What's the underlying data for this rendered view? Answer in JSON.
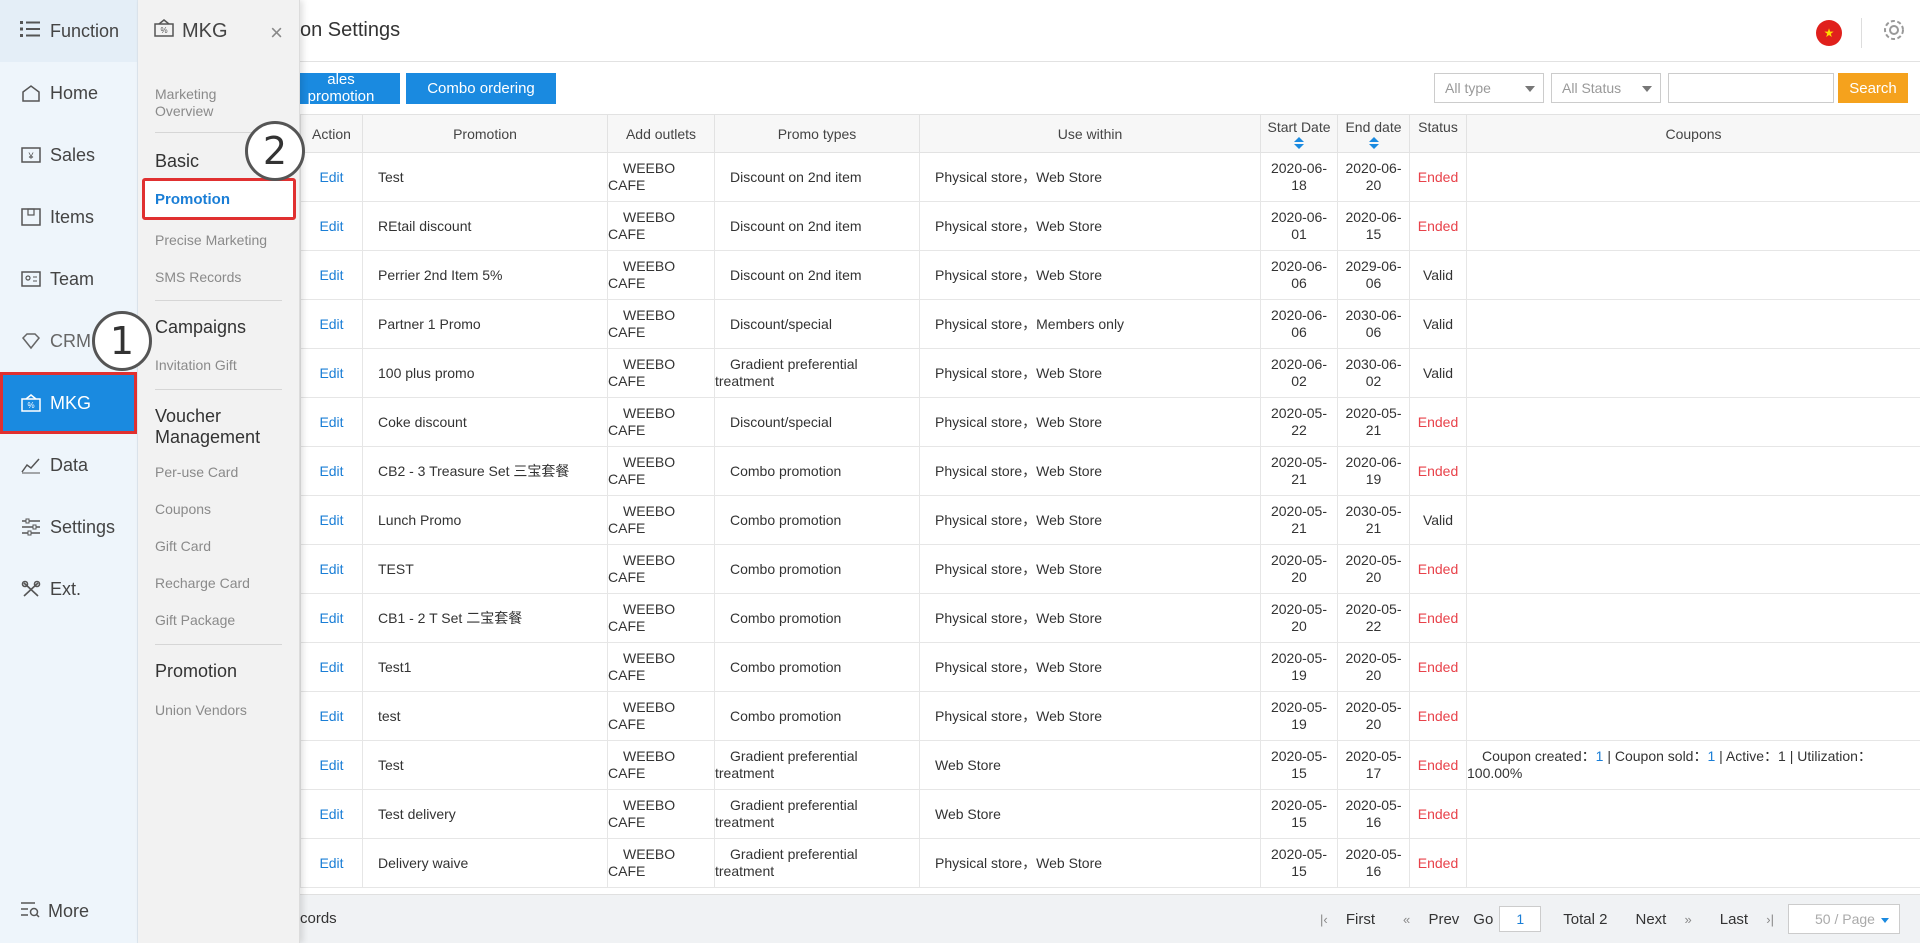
{
  "function_sidebar": {
    "header": "Function",
    "items": [
      {
        "label": "Home",
        "icon": "home-icon"
      },
      {
        "label": "Sales",
        "icon": "sales-icon"
      },
      {
        "label": "Items",
        "icon": "items-icon"
      },
      {
        "label": "Team",
        "icon": "team-icon"
      },
      {
        "label": "CRM",
        "icon": "crm-icon"
      },
      {
        "label": "MKG",
        "icon": "mkg-icon"
      },
      {
        "label": "Data",
        "icon": "data-icon"
      },
      {
        "label": "Settings",
        "icon": "settings-icon"
      },
      {
        "label": "Ext.",
        "icon": "ext-icon"
      }
    ],
    "more": "More"
  },
  "submenu": {
    "title": "MKG",
    "marketing_overview": "Marketing Overview",
    "basic": "Basic",
    "promotion": "Promotion",
    "precise_marketing": "Precise Marketing",
    "sms_records": "SMS Records",
    "campaigns": "Campaigns",
    "invitation_gift": "Invitation Gift",
    "voucher_management": "Voucher Management",
    "per_use_card": "Per-use Card",
    "coupons": "Coupons",
    "gift_card": "Gift Card",
    "recharge_card": "Recharge Card",
    "gift_package": "Gift Package",
    "promotion_section": "Promotion",
    "union_vendors": "Union Vendors"
  },
  "badges": {
    "step1": "1",
    "step2": "2"
  },
  "header": {
    "title": "on Settings"
  },
  "toolbar": {
    "sales_promotion": "ales promotion",
    "combo_ordering": "Combo ordering",
    "type_select": "All type",
    "status_select": "All Status",
    "search_value": "",
    "search_button": "Search"
  },
  "table": {
    "columns": {
      "action": "Action",
      "promotion": "Promotion",
      "add_outlets": "Add outlets",
      "promo_types": "Promo types",
      "use_within": "Use within",
      "start_date": "Start Date",
      "end_date": "End date",
      "status": "Status",
      "coupons": "Coupons"
    },
    "rows": [
      {
        "action": "Edit",
        "promotion": "Test",
        "outlet1": "WEEBO",
        "outlet2": "CAFE",
        "type1": "Discount on 2nd item",
        "type2": "",
        "use": "Physical store，Web Store",
        "start1": "2020-06-",
        "start2": "18",
        "end1": "2020-06-",
        "end2": "20",
        "status": "Ended",
        "coupon1": "",
        "coupon2": ""
      },
      {
        "action": "Edit",
        "promotion": "REtail discount",
        "outlet1": "WEEBO",
        "outlet2": "CAFE",
        "type1": "Discount on 2nd item",
        "type2": "",
        "use": "Physical store，Web Store",
        "start1": "2020-06-",
        "start2": "01",
        "end1": "2020-06-",
        "end2": "15",
        "status": "Ended",
        "coupon1": "",
        "coupon2": ""
      },
      {
        "action": "Edit",
        "promotion": "Perrier 2nd Item 5%",
        "outlet1": "WEEBO",
        "outlet2": "CAFE",
        "type1": "Discount on 2nd item",
        "type2": "",
        "use": "Physical store，Web Store",
        "start1": "2020-06-",
        "start2": "06",
        "end1": "2029-06-",
        "end2": "06",
        "status": "Valid",
        "coupon1": "",
        "coupon2": ""
      },
      {
        "action": "Edit",
        "promotion": "Partner 1 Promo",
        "outlet1": "WEEBO",
        "outlet2": "CAFE",
        "type1": "Discount/special",
        "type2": "",
        "use": "Physical store，Members only",
        "start1": "2020-06-",
        "start2": "06",
        "end1": "2030-06-",
        "end2": "06",
        "status": "Valid",
        "coupon1": "",
        "coupon2": ""
      },
      {
        "action": "Edit",
        "promotion": "100 plus promo",
        "outlet1": "WEEBO",
        "outlet2": "CAFE",
        "type1": "Gradient preferential",
        "type2": "treatment",
        "use": "Physical store，Web Store",
        "start1": "2020-06-",
        "start2": "02",
        "end1": "2030-06-",
        "end2": "02",
        "status": "Valid",
        "coupon1": "",
        "coupon2": ""
      },
      {
        "action": "Edit",
        "promotion": "Coke discount",
        "outlet1": "WEEBO",
        "outlet2": "CAFE",
        "type1": "Discount/special",
        "type2": "",
        "use": "Physical store，Web Store",
        "start1": "2020-05-",
        "start2": "22",
        "end1": "2020-05-",
        "end2": "21",
        "status": "Ended",
        "coupon1": "",
        "coupon2": ""
      },
      {
        "action": "Edit",
        "promotion": "CB2 - 3 Treasure Set 三宝套餐",
        "outlet1": "WEEBO",
        "outlet2": "CAFE",
        "type1": "Combo promotion",
        "type2": "",
        "use": "Physical store，Web Store",
        "start1": "2020-05-",
        "start2": "21",
        "end1": "2020-06-",
        "end2": "19",
        "status": "Ended",
        "coupon1": "",
        "coupon2": ""
      },
      {
        "action": "Edit",
        "promotion": "Lunch Promo",
        "outlet1": "WEEBO",
        "outlet2": "CAFE",
        "type1": "Combo promotion",
        "type2": "",
        "use": "Physical store，Web Store",
        "start1": "2020-05-",
        "start2": "21",
        "end1": "2030-05-",
        "end2": "21",
        "status": "Valid",
        "coupon1": "",
        "coupon2": ""
      },
      {
        "action": "Edit",
        "promotion": "TEST",
        "outlet1": "WEEBO",
        "outlet2": "CAFE",
        "type1": "Combo promotion",
        "type2": "",
        "use": "Physical store，Web Store",
        "start1": "2020-05-",
        "start2": "20",
        "end1": "2020-05-",
        "end2": "20",
        "status": "Ended",
        "coupon1": "",
        "coupon2": ""
      },
      {
        "action": "Edit",
        "promotion": "CB1 - 2 T Set 二宝套餐",
        "outlet1": "WEEBO",
        "outlet2": "CAFE",
        "type1": "Combo promotion",
        "type2": "",
        "use": "Physical store，Web Store",
        "start1": "2020-05-",
        "start2": "20",
        "end1": "2020-05-",
        "end2": "22",
        "status": "Ended",
        "coupon1": "",
        "coupon2": ""
      },
      {
        "action": "Edit",
        "promotion": "Test1",
        "outlet1": "WEEBO",
        "outlet2": "CAFE",
        "type1": "Combo promotion",
        "type2": "",
        "use": "Physical store，Web Store",
        "start1": "2020-05-",
        "start2": "19",
        "end1": "2020-05-",
        "end2": "20",
        "status": "Ended",
        "coupon1": "",
        "coupon2": ""
      },
      {
        "action": "Edit",
        "promotion": "test",
        "outlet1": "WEEBO",
        "outlet2": "CAFE",
        "type1": "Combo promotion",
        "type2": "",
        "use": "Physical store，Web Store",
        "start1": "2020-05-",
        "start2": "19",
        "end1": "2020-05-",
        "end2": "20",
        "status": "Ended",
        "coupon1": "",
        "coupon2": ""
      },
      {
        "action": "Edit",
        "promotion": "Test",
        "outlet1": "WEEBO",
        "outlet2": "CAFE",
        "type1": "Gradient preferential",
        "type2": "treatment",
        "use": "Web Store",
        "start1": "2020-05-",
        "start2": "15",
        "end1": "2020-05-",
        "end2": "17",
        "status": "Ended",
        "coupon1": "Coupon created：1 | Coupon sold：1 | Active：1 | Utilization：",
        "coupon2": "100.00%"
      },
      {
        "action": "Edit",
        "promotion": "Test delivery",
        "outlet1": "WEEBO",
        "outlet2": "CAFE",
        "type1": "Gradient preferential",
        "type2": "treatment",
        "use": "Web Store",
        "start1": "2020-05-",
        "start2": "15",
        "end1": "2020-05-",
        "end2": "16",
        "status": "Ended",
        "coupon1": "",
        "coupon2": ""
      },
      {
        "action": "Edit",
        "promotion": "Delivery waive",
        "outlet1": "WEEBO",
        "outlet2": "CAFE",
        "type1": "Gradient preferential",
        "type2": "treatment",
        "use": "Physical store，Web Store",
        "start1": "2020-05-",
        "start2": "15",
        "end1": "2020-05-",
        "end2": "16",
        "status": "Ended",
        "coupon1": "",
        "coupon2": ""
      }
    ]
  },
  "coupon_detail": {
    "prefix": "Coupon created：",
    "created": "1",
    "sold_label": " | Coupon sold：",
    "sold": "1",
    "rest": " | Active：1 | Utilization：",
    "line2": "100.00%"
  },
  "footer": {
    "records": "cords",
    "first": "First",
    "prev": "Prev",
    "go": "Go",
    "page": "1",
    "total": "Total 2",
    "next": "Next",
    "last": "Last",
    "page_size": "50 / Page"
  },
  "colors": {
    "accent": "#1a8ae0",
    "search": "#f5a21d",
    "ended": "#e8424a",
    "highlight": "#e03030"
  }
}
